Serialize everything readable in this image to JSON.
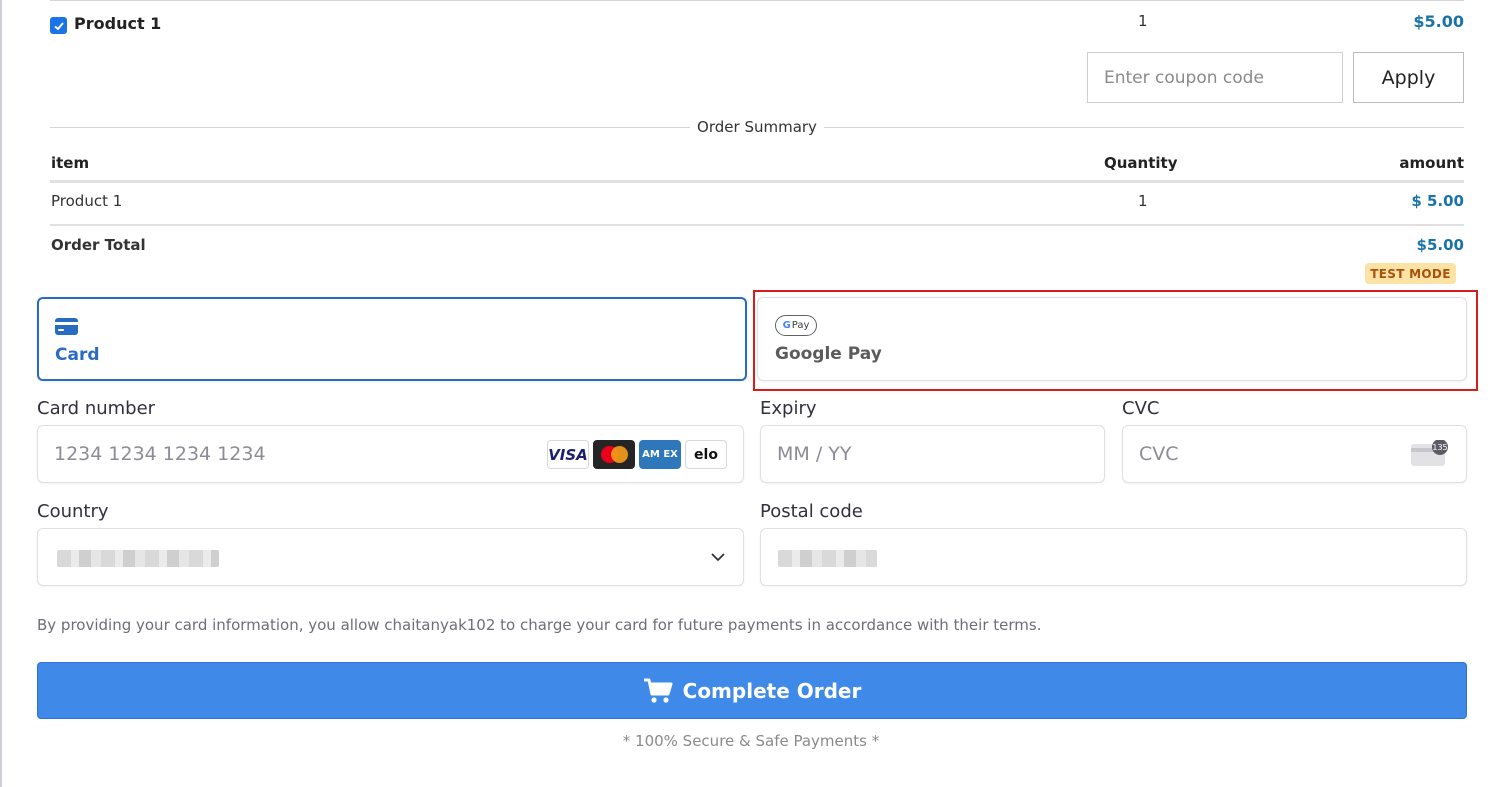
{
  "product": {
    "checked": true,
    "name": "Product 1",
    "quantity": "1",
    "price": "$5.00"
  },
  "coupon": {
    "placeholder": "Enter coupon code",
    "apply_label": "Apply"
  },
  "summary": {
    "title": "Order Summary",
    "headers": {
      "item": "item",
      "quantity": "Quantity",
      "amount": "amount"
    },
    "rows": [
      {
        "item": "Product 1",
        "quantity": "1",
        "amount": "$ 5.00"
      }
    ],
    "total_label": "Order Total",
    "total_amount": "$5.00"
  },
  "badge": {
    "test_mode": "TEST MODE"
  },
  "payment_tabs": {
    "card_label": "Card",
    "gpay_label": "Google Pay",
    "gpay_icon_text": "Pay"
  },
  "form": {
    "card_number_label": "Card number",
    "card_number_placeholder": "1234 1234 1234 1234",
    "expiry_label": "Expiry",
    "expiry_placeholder": "MM / YY",
    "cvc_label": "CVC",
    "cvc_placeholder": "CVC",
    "cvc_icon_text": "135",
    "country_label": "Country",
    "postal_label": "Postal code",
    "brands": {
      "visa": "VISA",
      "amex": "AM EX",
      "elo": "elo"
    }
  },
  "terms": "By providing your card information, you allow chaitanyak102 to charge your card for future payments in accordance with their terms.",
  "complete_button_label": "Complete Order",
  "secure_note": "* 100% Secure & Safe Payments *",
  "colors": {
    "accent": "#1a73a8",
    "primary_button": "#3f8ae8",
    "card_tab": "#2a6bc2",
    "highlight": "#d81b1b",
    "badge_bg": "#fde2a6",
    "badge_text": "#a6520d"
  }
}
